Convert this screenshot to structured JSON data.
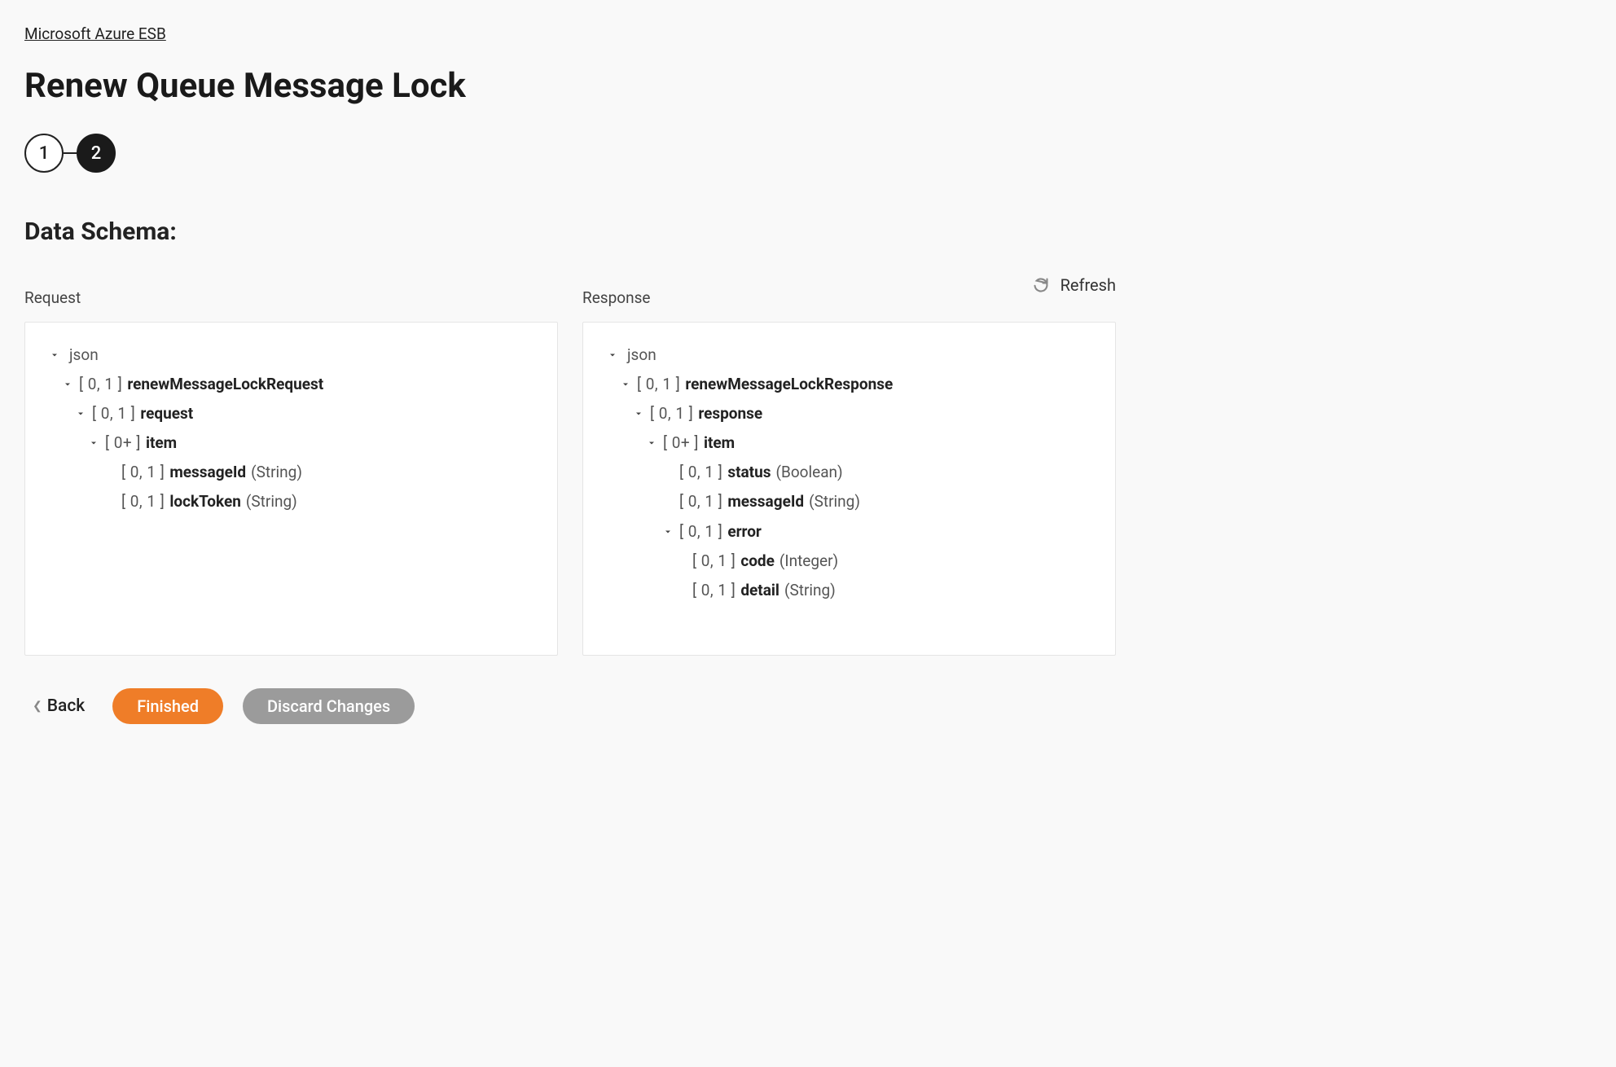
{
  "breadcrumb": "Microsoft Azure ESB",
  "title": "Renew Queue Message Lock",
  "steps": [
    "1",
    "2"
  ],
  "activeStepIndex": 1,
  "sectionTitle": "Data Schema:",
  "refreshLabel": "Refresh",
  "columns": {
    "left": {
      "label": "Request"
    },
    "right": {
      "label": "Response"
    }
  },
  "trees": {
    "request": [
      {
        "indent": 0,
        "chevron": true,
        "card": "",
        "name": "",
        "type": "",
        "root": "json"
      },
      {
        "indent": 1,
        "chevron": true,
        "card": "[ 0, 1 ]",
        "name": "renewMessageLockRequest",
        "type": ""
      },
      {
        "indent": 2,
        "chevron": true,
        "card": "[ 0, 1 ]",
        "name": "request",
        "type": ""
      },
      {
        "indent": 3,
        "chevron": true,
        "card": "[ 0+ ]",
        "name": "item",
        "type": ""
      },
      {
        "indent": 4,
        "chevron": false,
        "card": "[ 0, 1 ]",
        "name": "messageId",
        "type": "(String)"
      },
      {
        "indent": 4,
        "chevron": false,
        "card": "[ 0, 1 ]",
        "name": "lockToken",
        "type": "(String)"
      }
    ],
    "response": [
      {
        "indent": 0,
        "chevron": true,
        "card": "",
        "name": "",
        "type": "",
        "root": "json"
      },
      {
        "indent": 1,
        "chevron": true,
        "card": "[ 0, 1 ]",
        "name": "renewMessageLockResponse",
        "type": ""
      },
      {
        "indent": 2,
        "chevron": true,
        "card": "[ 0, 1 ]",
        "name": "response",
        "type": ""
      },
      {
        "indent": 3,
        "chevron": true,
        "card": "[ 0+ ]",
        "name": "item",
        "type": ""
      },
      {
        "indent": 4,
        "chevron": false,
        "card": "[ 0, 1 ]",
        "name": "status",
        "type": "(Boolean)"
      },
      {
        "indent": 4,
        "chevron": false,
        "card": "[ 0, 1 ]",
        "name": "messageId",
        "type": "(String)"
      },
      {
        "indent": 4,
        "chevron": true,
        "card": "[ 0, 1 ]",
        "name": "error",
        "type": ""
      },
      {
        "indent": 5,
        "chevron": false,
        "card": "[ 0, 1 ]",
        "name": "code",
        "type": "(Integer)"
      },
      {
        "indent": 5,
        "chevron": false,
        "card": "[ 0, 1 ]",
        "name": "detail",
        "type": "(String)"
      }
    ]
  },
  "footer": {
    "back": "Back",
    "finished": "Finished",
    "discard": "Discard Changes"
  }
}
